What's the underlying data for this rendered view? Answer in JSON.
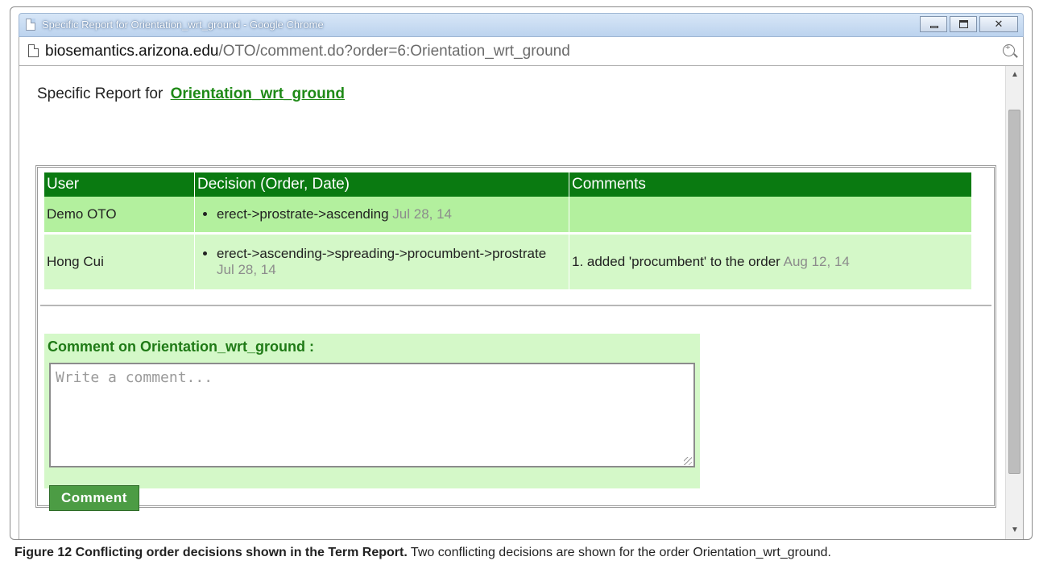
{
  "window": {
    "title": "Specific Report for Orientation_wrt_ground - Google Chrome",
    "close_glyph": "✕"
  },
  "address": {
    "host": "biosemantics.arizona.edu",
    "path": "/OTO/comment.do?order=6:Orientation_wrt_ground"
  },
  "report": {
    "heading_prefix": "Specific Report for",
    "heading_link": "Orientation_wrt_ground",
    "table": {
      "headers": [
        "User",
        "Decision (Order, Date)",
        "Comments"
      ],
      "rows": [
        {
          "user": "Demo OTO",
          "decision": "erect->prostrate->ascending",
          "decision_date": "Jul 28, 14",
          "comment": "",
          "comment_date": ""
        },
        {
          "user": "Hong Cui",
          "decision": "erect->ascending->spreading->procumbent->prostrate",
          "decision_date": "Jul 28, 14",
          "comment": "1. added 'procumbent' to the order",
          "comment_date": "Aug 12, 14"
        }
      ]
    },
    "comment_form": {
      "label": "Comment on Orientation_wrt_ground :",
      "placeholder": "Write a comment...",
      "button": "Comment"
    }
  },
  "caption": {
    "bold": "Figure 12 Conflicting order decisions shown in the Term Report.",
    "text": "Two conflicting decisions are shown for the order Orientation_wrt_ground."
  },
  "colors": {
    "header_green": "#0a7a11",
    "row_green": "#b3f09e",
    "row_alt_green": "#d4f8c8",
    "link_green": "#1f8a17",
    "button_green": "#4c9c44"
  }
}
